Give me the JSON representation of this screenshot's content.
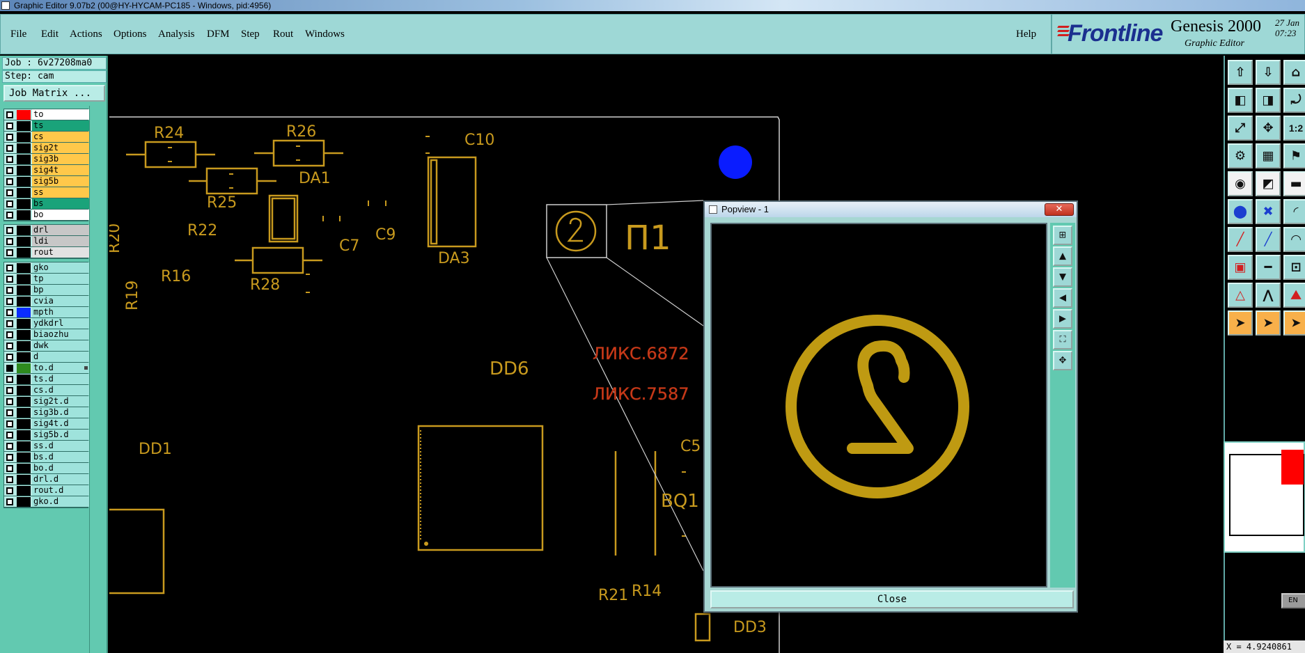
{
  "window": {
    "title": "Graphic Editor 9.07b2 (00@HY-HYCAM-PC185 - Windows, pid:4956)"
  },
  "menu": {
    "items": [
      "File",
      "Edit",
      "Actions",
      "Options",
      "Analysis",
      "DFM",
      "Step",
      "Rout",
      "Windows"
    ],
    "help": "Help"
  },
  "brand": {
    "logo": "Frontline",
    "product": "Genesis 2000",
    "subtitle": "Graphic Editor",
    "date_line1": "27 Jan",
    "date_line2": "07:23"
  },
  "job": {
    "job_line": "Job : 6v27208ma0",
    "step_line": "Step: cam",
    "matrix_button": "Job Matrix ..."
  },
  "layers": {
    "group1": [
      {
        "name": "to",
        "swatch": "#ff0000",
        "bg": "#ffffff"
      },
      {
        "name": "ts",
        "swatch": "#000000",
        "bg": "#1aa37a"
      },
      {
        "name": "cs",
        "swatch": "#000000",
        "bg": "#ffc84a"
      },
      {
        "name": "sig2t",
        "swatch": "#000000",
        "bg": "#ffc84a"
      },
      {
        "name": "sig3b",
        "swatch": "#000000",
        "bg": "#ffc84a"
      },
      {
        "name": "sig4t",
        "swatch": "#000000",
        "bg": "#ffc84a"
      },
      {
        "name": "sig5b",
        "swatch": "#000000",
        "bg": "#ffc84a"
      },
      {
        "name": "ss",
        "swatch": "#000000",
        "bg": "#ffc84a"
      },
      {
        "name": "bs",
        "swatch": "#000000",
        "bg": "#1aa37a"
      },
      {
        "name": "bo",
        "swatch": "#000000",
        "bg": "#ffffff"
      }
    ],
    "group2": [
      {
        "name": "drl",
        "swatch": "#000000",
        "bg": "#c7c7c7"
      },
      {
        "name": "ldi",
        "swatch": "#000000",
        "bg": "#c7c7c7"
      },
      {
        "name": "rout",
        "swatch": "#000000",
        "bg": "#e2e2e2"
      }
    ],
    "group3": [
      {
        "name": "gko",
        "swatch": "#000000",
        "bg": "#9fe3dc"
      },
      {
        "name": "tp",
        "swatch": "#000000",
        "bg": "#9fe3dc"
      },
      {
        "name": "bp",
        "swatch": "#000000",
        "bg": "#9fe3dc"
      },
      {
        "name": "cvia",
        "swatch": "#000000",
        "bg": "#9fe3dc"
      },
      {
        "name": "mpth",
        "swatch": "#0a2cff",
        "bg": "#9fe3dc"
      },
      {
        "name": "ydkdrl",
        "swatch": "#000000",
        "bg": "#9fe3dc"
      },
      {
        "name": "biaozhu",
        "swatch": "#000000",
        "bg": "#9fe3dc"
      },
      {
        "name": "dwk",
        "swatch": "#000000",
        "bg": "#9fe3dc"
      },
      {
        "name": "d",
        "swatch": "#000000",
        "bg": "#9fe3dc"
      },
      {
        "name": "to.d",
        "swatch": "#2e8a1e",
        "bg": "#9fe3dc",
        "active": true
      },
      {
        "name": "ts.d",
        "swatch": "#000000",
        "bg": "#9fe3dc"
      },
      {
        "name": "cs.d",
        "swatch": "#000000",
        "bg": "#9fe3dc"
      },
      {
        "name": "sig2t.d",
        "swatch": "#000000",
        "bg": "#9fe3dc"
      },
      {
        "name": "sig3b.d",
        "swatch": "#000000",
        "bg": "#9fe3dc"
      },
      {
        "name": "sig4t.d",
        "swatch": "#000000",
        "bg": "#9fe3dc"
      },
      {
        "name": "sig5b.d",
        "swatch": "#000000",
        "bg": "#9fe3dc"
      },
      {
        "name": "ss.d",
        "swatch": "#000000",
        "bg": "#9fe3dc"
      },
      {
        "name": "bs.d",
        "swatch": "#000000",
        "bg": "#9fe3dc"
      },
      {
        "name": "bo.d",
        "swatch": "#000000",
        "bg": "#9fe3dc"
      },
      {
        "name": "drl.d",
        "swatch": "#000000",
        "bg": "#9fe3dc"
      },
      {
        "name": "rout.d",
        "swatch": "#000000",
        "bg": "#9fe3dc"
      },
      {
        "name": "gko.d",
        "swatch": "#000000",
        "bg": "#9fe3dc"
      }
    ]
  },
  "canvas": {
    "silk_color": "#c89a1e",
    "labels": [
      "R24",
      "R26",
      "C10",
      "DA1",
      "R25",
      "R22",
      "C7",
      "C9",
      "R20",
      "DA3",
      "R16",
      "R28",
      "R19",
      "П1",
      "DD6",
      "DD1",
      "C5",
      "BQ1",
      "R21",
      "R14",
      "DD3"
    ],
    "red_texts": [
      "ЛИКС.6872",
      "ЛИКС.7587"
    ],
    "marker_color": "#0a1cff",
    "marker_label": "2"
  },
  "popview": {
    "title": "Popview - 1",
    "close_x": "✕",
    "close_button": "Close",
    "glyph": "2"
  },
  "status": {
    "x_readout": "X = 4.9240861",
    "enter_label": "EN"
  },
  "tool_icons": [
    "layer-up-icon",
    "layer-down-icon",
    "building-icon",
    "pan-left-icon",
    "pan-right-icon",
    "zoom-ratio-icon",
    "fit-icon",
    "center-icon",
    "scale-12-icon",
    "measure-icon",
    "grid-icon",
    "snap-icon",
    "select-tool-icon",
    "shape-icon",
    "ruler-icon",
    "connect-icon",
    "delete-point-icon",
    "arc-icon",
    "line-red-icon",
    "line-blue-icon",
    "curve-icon",
    "pad-icon",
    "segment-icon",
    "box-icon",
    "triangle-icon",
    "peak-icon",
    "mountain-icon",
    "pointer-icon",
    "pointer-alt-icon",
    "pointer-orange-icon"
  ]
}
